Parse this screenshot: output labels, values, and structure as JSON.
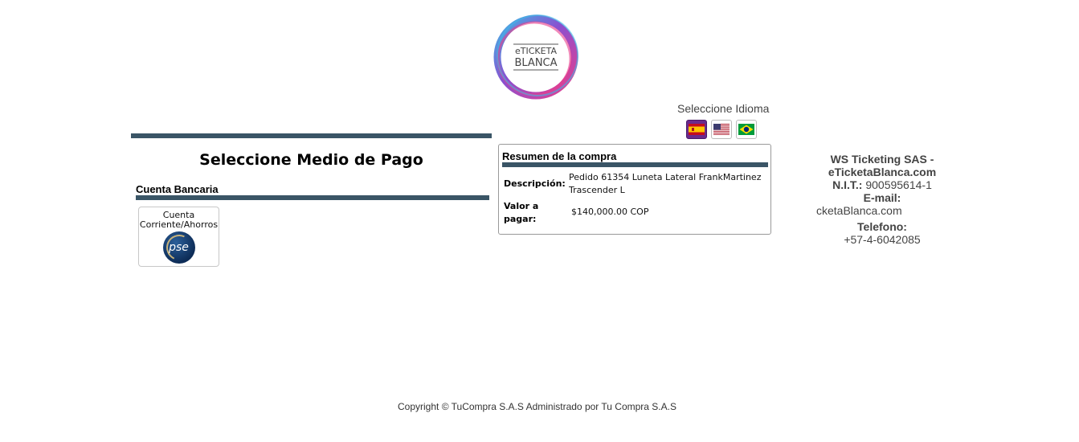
{
  "brand": {
    "logo_line1": "eTICKETA",
    "logo_line2": "BLANCA"
  },
  "language": {
    "label": "Seleccione Idioma",
    "flags": [
      {
        "icon": "spain-flag-icon",
        "active": true
      },
      {
        "icon": "usa-flag-icon",
        "active": false
      },
      {
        "icon": "brazil-flag-icon",
        "active": false
      }
    ]
  },
  "payment": {
    "title": "Seleccione Medio de Pago",
    "section_label": "Cuenta Bancaria",
    "option": {
      "label": "Cuenta Corriente/Ahorros",
      "logo_text": "pse"
    }
  },
  "summary": {
    "title": "Resumen de la compra",
    "description_label": "Descripción:",
    "description_value": "Pedido 61354 Luneta Lateral FrankMartinez Trascender L",
    "amount_label": "Valor a pagar:",
    "amount_value": "$140,000.00 COP"
  },
  "company": {
    "name": "WS Ticketing SAS - eTicketaBlanca.com",
    "nit_label": "N.I.T.:",
    "nit_value": "900595614-1",
    "email_label": "E-mail:",
    "email_value": "cketaBlanca.com",
    "phone_label": "Telefono:",
    "phone_value": "+57-4-6042085"
  },
  "footer": {
    "text": "Copyright © TuCompra S.A.S Administrado por Tu Compra S.A.S"
  },
  "colors": {
    "bar": "#3a5566",
    "accent_pink": "#e83e8c",
    "accent_blue": "#3fb7e6",
    "accent_purple": "#6a2a8c"
  }
}
